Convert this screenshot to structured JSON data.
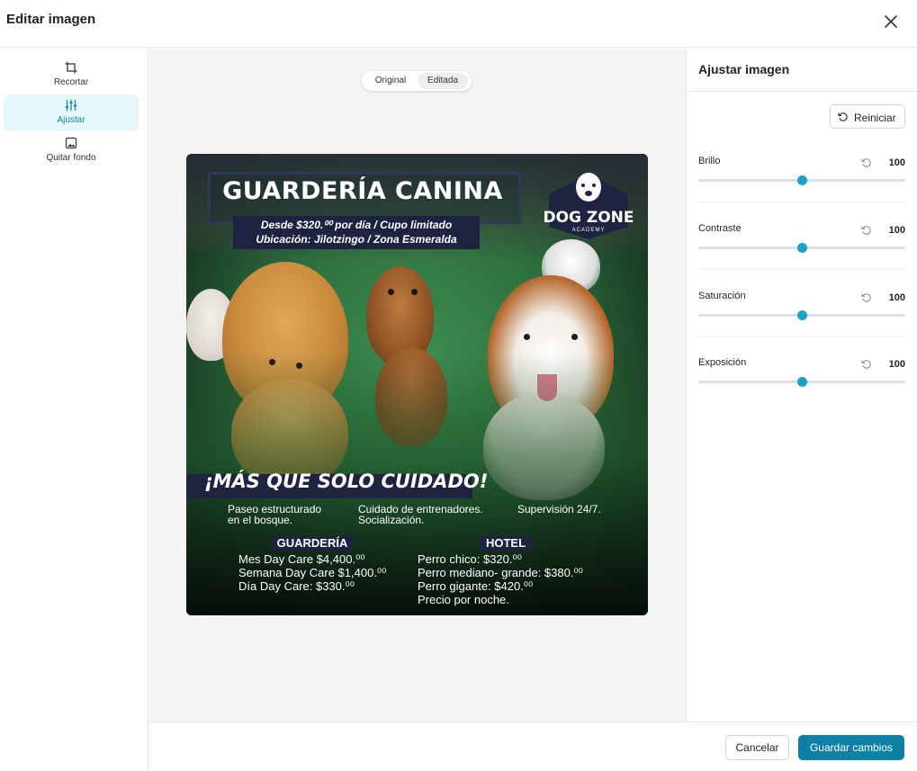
{
  "dialog": {
    "title": "Editar imagen"
  },
  "tools": [
    {
      "label": "Recortar",
      "icon": "crop-icon",
      "active": false
    },
    {
      "label": "Ajustar",
      "icon": "sliders-icon",
      "active": true
    },
    {
      "label": "Quitar fondo",
      "icon": "image-icon",
      "active": false
    }
  ],
  "view_toggle": {
    "options": [
      "Original",
      "Editada"
    ],
    "selected": "Editada"
  },
  "poster": {
    "title": "GUARDERÍA CANINA",
    "subtitle_1": "Desde $320.⁰⁰ por día / Cupo limitado",
    "subtitle_2": "Ubicación: Jilotzingo / Zona Esmeralda",
    "logo_brand": "DOG ZONE",
    "logo_sub": "ACADEMY",
    "tagline": "¡MÁS QUE SOLO CUIDADO!",
    "features": [
      {
        "line1": "Paseo estructurado",
        "line2": "en el bosque."
      },
      {
        "line1": "Cuidado de entrenadores.",
        "line2": "Socialización."
      },
      {
        "line1": "Supervisión 24/7.",
        "line2": ""
      }
    ],
    "guarderia": {
      "heading": "GUARDERÍA",
      "items": [
        "Mes Day Care $4,400.⁰⁰",
        "Semana Day Care $1,400.⁰⁰",
        "Día Day Care: $330.⁰⁰"
      ]
    },
    "hotel": {
      "heading": "HOTEL",
      "items": [
        "Perro chico: $320.⁰⁰",
        "Perro mediano- grande: $380.⁰⁰",
        "Perro gigante: $420.⁰⁰",
        "Precio por noche."
      ]
    }
  },
  "panel": {
    "title": "Ajustar imagen",
    "reset_label": "Reiniciar",
    "adjustments": [
      {
        "label": "Brillo",
        "value": "100",
        "fraction": 0.5
      },
      {
        "label": "Contraste",
        "value": "100",
        "fraction": 0.5
      },
      {
        "label": "Saturación",
        "value": "100",
        "fraction": 0.5
      },
      {
        "label": "Exposición",
        "value": "100",
        "fraction": 0.5
      }
    ]
  },
  "footer": {
    "cancel_label": "Cancelar",
    "save_label": "Guardar cambios"
  },
  "colors": {
    "accent": "#1aa3c7",
    "primary_button": "#0e7fa5",
    "active_tool_bg": "#e6f7fb"
  }
}
